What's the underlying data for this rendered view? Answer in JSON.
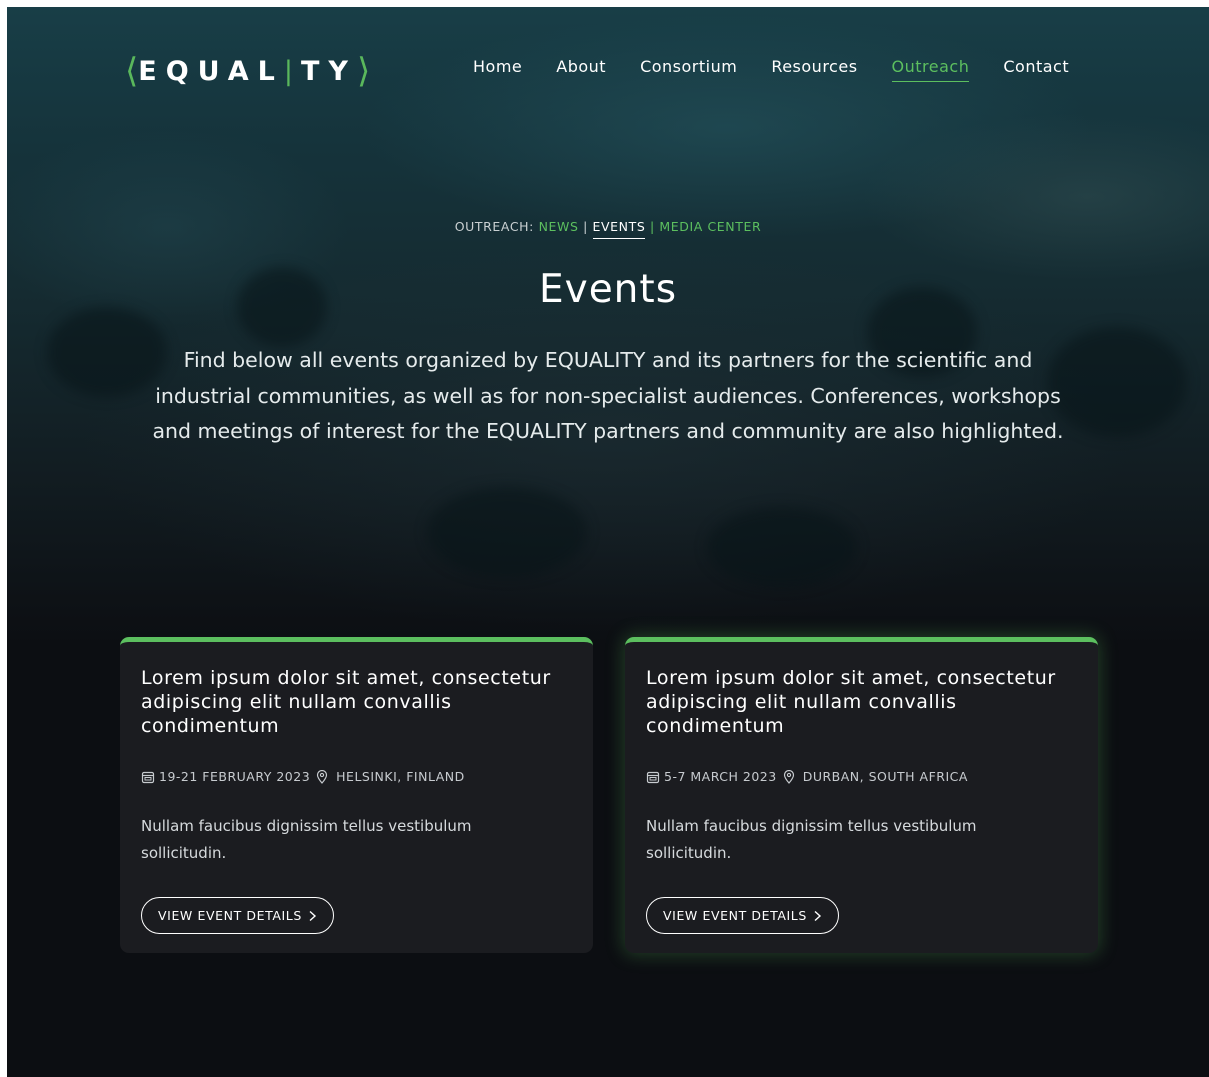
{
  "brand": {
    "logo_text": "EQUAL|TY",
    "name": "EQUALITY",
    "accent_color": "#5cbf5f"
  },
  "nav": {
    "items": [
      {
        "label": "Home",
        "active": false
      },
      {
        "label": "About",
        "active": false
      },
      {
        "label": "Consortium",
        "active": false
      },
      {
        "label": "Resources",
        "active": false
      },
      {
        "label": "Outreach",
        "active": true
      },
      {
        "label": "Contact",
        "active": false
      }
    ]
  },
  "subnav": {
    "prefix": "OUTREACH:",
    "items": [
      {
        "label": "NEWS",
        "active": false
      },
      {
        "label": "EVENTS",
        "active": true
      },
      {
        "label": "MEDIA CENTER",
        "active": false
      }
    ],
    "separator": "|"
  },
  "hero": {
    "title": "Events",
    "intro": "Find below all events organized by EQUALITY and its partners for the scientific and industrial communities, as well as for non-specialist audiences. Conferences, workshops and meetings of interest for the EQUALITY partners and community are also highlighted."
  },
  "events": [
    {
      "title": "Lorem ipsum dolor sit amet, consectetur adipiscing elit nullam convallis condimentum",
      "date": "19-21 FEBRUARY 2023",
      "location": "HELSINKI, FINLAND",
      "description": "Nullam faucibus dignissim tellus vestibulum sollicitudin.",
      "button_label": "VIEW EVENT DETAILS",
      "highlighted": false
    },
    {
      "title": "Lorem ipsum dolor sit amet, consectetur adipiscing elit nullam convallis condimentum",
      "date": "5-7 MARCH 2023",
      "location": "DURBAN, SOUTH AFRICA",
      "description": "Nullam faucibus dignissim tellus vestibulum sollicitudin.",
      "button_label": "VIEW EVENT DETAILS",
      "highlighted": true
    }
  ],
  "icons": {
    "date": "calendar-icon",
    "location": "map-pin-icon",
    "button": "chevron-right-icon"
  }
}
